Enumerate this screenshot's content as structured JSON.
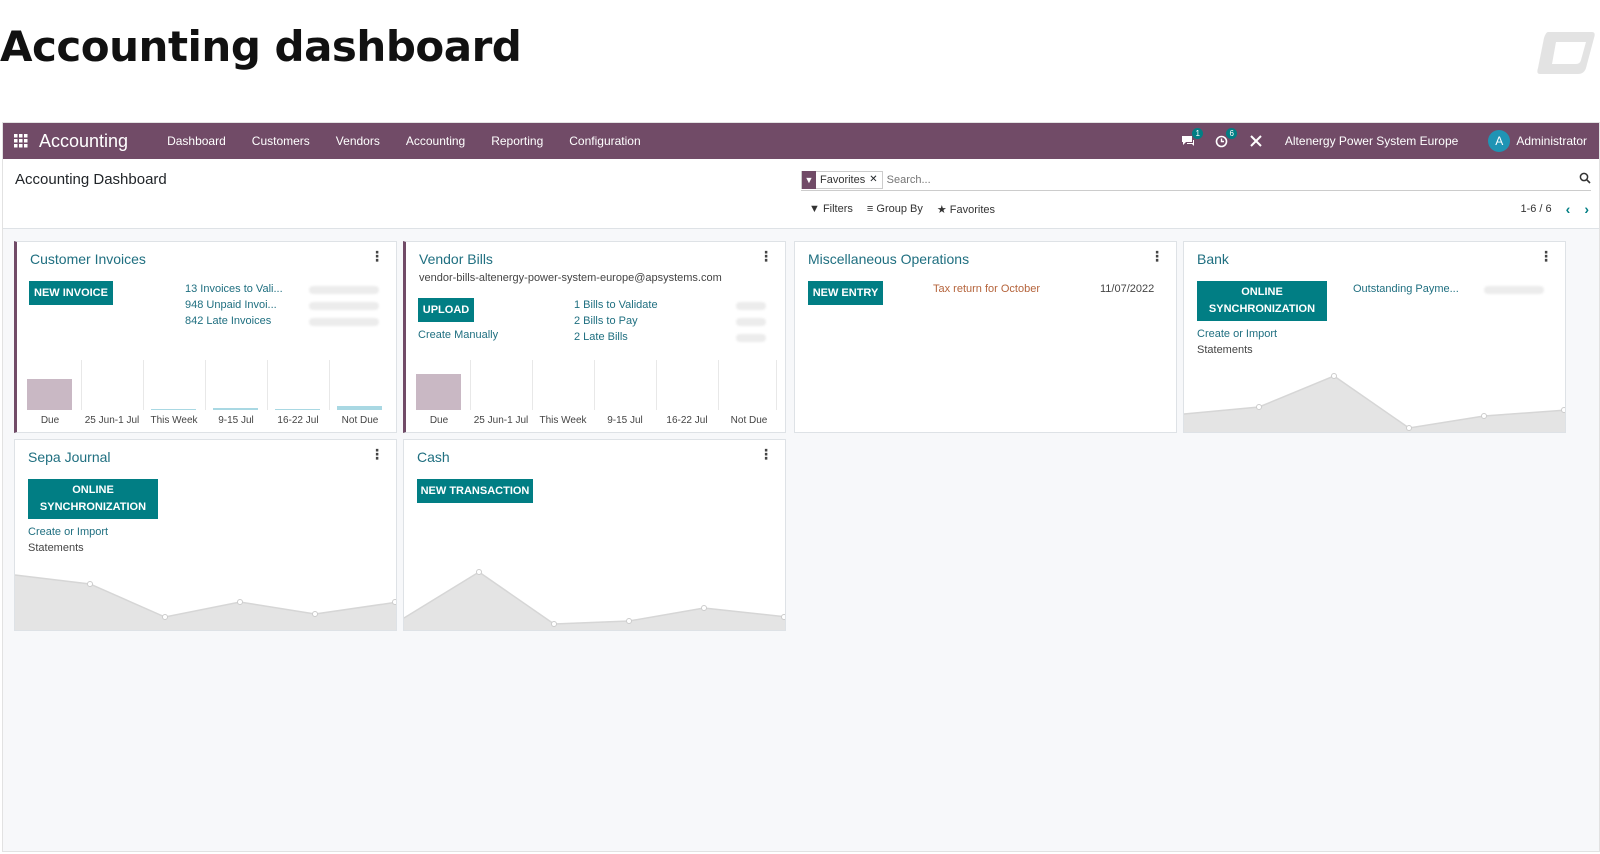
{
  "slide": {
    "title": "Accounting dashboard"
  },
  "navbar": {
    "app_name": "Accounting",
    "menu": [
      "Dashboard",
      "Customers",
      "Vendors",
      "Accounting",
      "Reporting",
      "Configuration"
    ],
    "messages_count": "1",
    "activities_count": "6",
    "company": "Altenergy Power System Europe",
    "user_initial": "A",
    "user_name": "Administrator"
  },
  "control": {
    "breadcrumb": "Accounting Dashboard",
    "facet_label": "Favorites",
    "search_placeholder": "Search...",
    "filters_label": "Filters",
    "groupby_label": "Group By",
    "favorites_label": "Favorites",
    "pager": "1-6 / 6"
  },
  "cards": {
    "customer_invoices": {
      "title": "Customer Invoices",
      "button": "New Invoice",
      "links": [
        "13 Invoices to Vali...",
        "948 Unpaid Invoi...",
        "842 Late Invoices"
      ],
      "bar_labels": [
        "Due",
        "25 Jun-1 Jul",
        "This Week",
        "9-15 Jul",
        "16-22 Jul",
        "Not Due"
      ]
    },
    "vendor_bills": {
      "title": "Vendor Bills",
      "email": "vendor-bills-altenergy-power-system-europe@apsystems.com",
      "button": "Upload",
      "create_manually": "Create Manually",
      "links": [
        "1 Bills to Validate",
        "2 Bills to Pay",
        "2 Late Bills"
      ],
      "bar_labels": [
        "Due",
        "25 Jun-1 Jul",
        "This Week",
        "9-15 Jul",
        "16-22 Jul",
        "Not Due"
      ]
    },
    "misc": {
      "title": "Miscellaneous Operations",
      "button": "New Entry",
      "tax_return": "Tax return for October",
      "tax_date": "11/07/2022"
    },
    "bank": {
      "title": "Bank",
      "button": "Online Synchronization",
      "create_import": "Create or Import",
      "statements": "Statements",
      "outstanding": "Outstanding Payme..."
    },
    "sepa": {
      "title": "Sepa Journal",
      "button": "Online Synchronization",
      "create_import": "Create or Import",
      "statements": "Statements"
    },
    "cash": {
      "title": "Cash",
      "button": "New Transaction"
    }
  },
  "colors": {
    "navbar": "#714b67",
    "primary": "#017e84",
    "link": "#1f6f80",
    "due_bar": "#c9b8c4",
    "future_bar": "#a9d8e3",
    "tax_return": "#b5643c"
  }
}
